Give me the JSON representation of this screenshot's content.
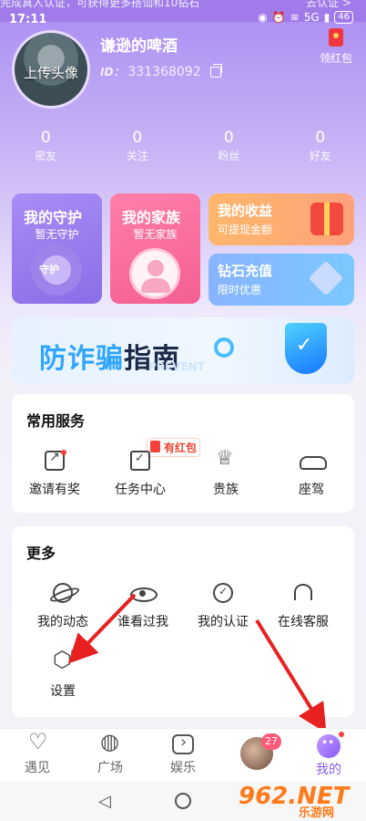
{
  "status_bar": {
    "time": "17:11",
    "notice": "完成真人认证，可获得更多搭讪和10钻石",
    "notice_right": "去认证 >",
    "battery": "46",
    "network": "5G"
  },
  "profile": {
    "avatar_label": "上传头像",
    "username": "谦逊的啤酒",
    "id_label": "ID：",
    "id_value": "331368092",
    "red_packet_label": "领红包"
  },
  "stats": [
    {
      "value": "0",
      "label": "密友"
    },
    {
      "value": "0",
      "label": "关注"
    },
    {
      "value": "0",
      "label": "粉丝"
    },
    {
      "value": "0",
      "label": "好友"
    }
  ],
  "cards": {
    "guard": {
      "title": "我的守护",
      "subtitle": "暂无守护",
      "badge": "守护"
    },
    "family": {
      "title": "我的家族",
      "subtitle": "暂无家族"
    },
    "income": {
      "title": "我的收益",
      "subtitle": "可提现金额"
    },
    "recharge": {
      "title": "钻石充值",
      "subtitle": "限时优惠"
    }
  },
  "banner": {
    "text_blue": "防诈骗",
    "text_dark": "指南",
    "sub": "PREVENT"
  },
  "services": {
    "title": "常用服务",
    "red_packet_tag": "有红包",
    "items": [
      {
        "label": "邀请有奖",
        "icon": "invite-icon"
      },
      {
        "label": "任务中心",
        "icon": "task-icon"
      },
      {
        "label": "贵族",
        "icon": "crown-icon"
      },
      {
        "label": "座驾",
        "icon": "car-icon"
      }
    ]
  },
  "more": {
    "title": "更多",
    "items": [
      {
        "label": "我的动态",
        "icon": "planet-icon"
      },
      {
        "label": "谁看过我",
        "icon": "eye-icon"
      },
      {
        "label": "我的认证",
        "icon": "certified-icon"
      },
      {
        "label": "在线客服",
        "icon": "headset-icon"
      },
      {
        "label": "设置",
        "icon": "gear-icon"
      }
    ]
  },
  "bottom_nav": {
    "items": [
      {
        "label": "遇见",
        "icon": "heart-pulse-icon"
      },
      {
        "label": "广场",
        "icon": "planet-icon"
      },
      {
        "label": "娱乐",
        "icon": "play-icon"
      },
      {
        "label": "",
        "icon": "live-avatar"
      },
      {
        "label": "我的",
        "icon": "mine-icon"
      }
    ],
    "live_badge": "27"
  },
  "watermark": {
    "logo": "962",
    "suffix": ".NET",
    "text": "乐游网"
  },
  "colors": {
    "accent": "#8a5cf5",
    "guard_card": "#9a7ef0",
    "family_card": "#f76b9c",
    "income_card": "#ffae72",
    "recharge_card": "#84bdff",
    "annotation_arrow": "#e8201f"
  }
}
